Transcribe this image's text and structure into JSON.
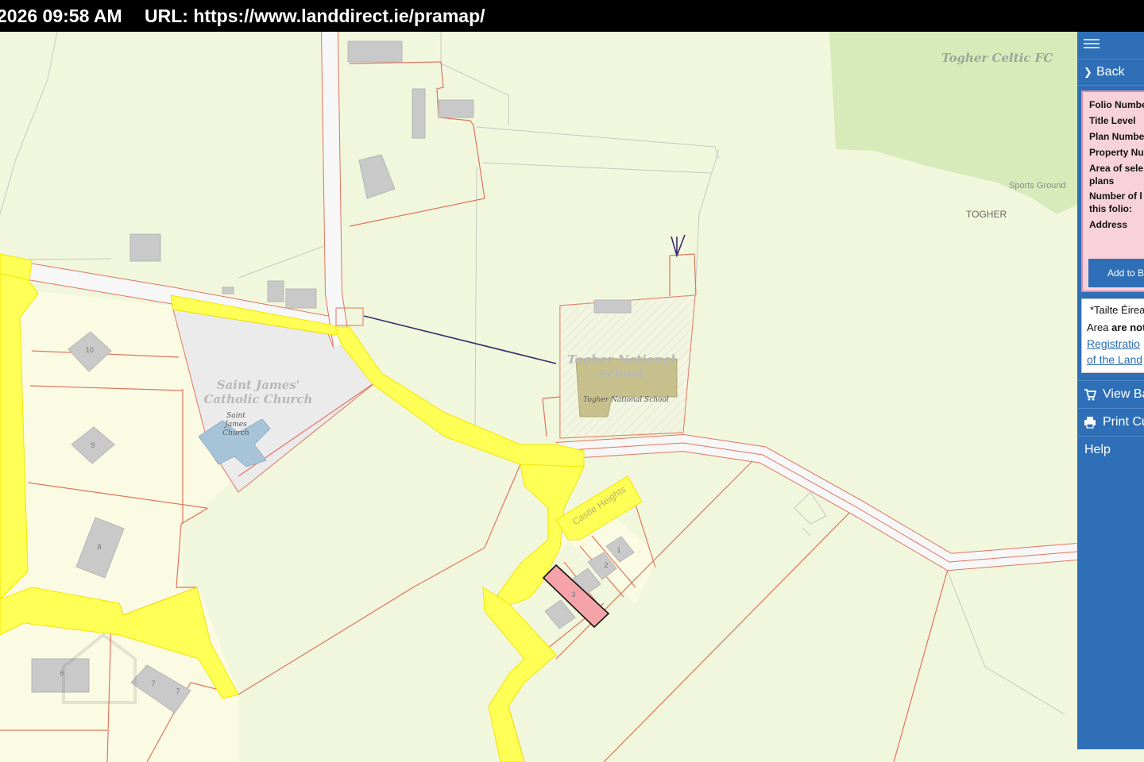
{
  "header": {
    "timestamp": "2026 09:58 AM",
    "url": "URL: https://www.landdirect.ie/pramap/"
  },
  "map_labels": {
    "togher_celtic": "Togher Celtic FC",
    "sports_ground": "Sports Ground",
    "togher": "TOGHER",
    "church_name_line1": "Saint James'",
    "church_name_line2": "Catholic Church",
    "church_small_line1": "Saint",
    "church_small_line2": "James",
    "church_small_line3": "Church",
    "school_line1": "Togher National",
    "school_line2": "School",
    "school_small": "Togher National School",
    "castle_heights": "Castle Heights",
    "house_10": "10",
    "house_9": "9",
    "house_8": "8",
    "house_7a": "7",
    "house_7b": "7",
    "house_6": "6",
    "house_1": "1",
    "house_2": "2",
    "house_3": "3"
  },
  "sidebar": {
    "back_label": "Back",
    "folio": {
      "folio_number": "Folio Numbe",
      "title_level": "Title Level",
      "plan_number": "Plan Numbe",
      "property_number": "Property Nu",
      "area_line1": "Area of sele",
      "area_line2": "plans",
      "number_line1": "Number of l",
      "number_line2": "this folio:",
      "address": "Address",
      "add_button": "Add to B"
    },
    "notice": {
      "line1": "*Tailte Éirea",
      "line2_prefix": "Area ",
      "line2_bold": "are not",
      "link1": "Registratio",
      "link2": "of the Land"
    },
    "nav": {
      "view_basket": "View Ba",
      "print": "Print Cu",
      "help": "Help"
    }
  },
  "colors": {
    "map_background": "#f1f7dc",
    "road_yellow": "#ffff55",
    "boundary_red": "#e0745f",
    "sidebar_blue": "#2f6fb7",
    "selected_parcel": "#f5a3a8"
  }
}
